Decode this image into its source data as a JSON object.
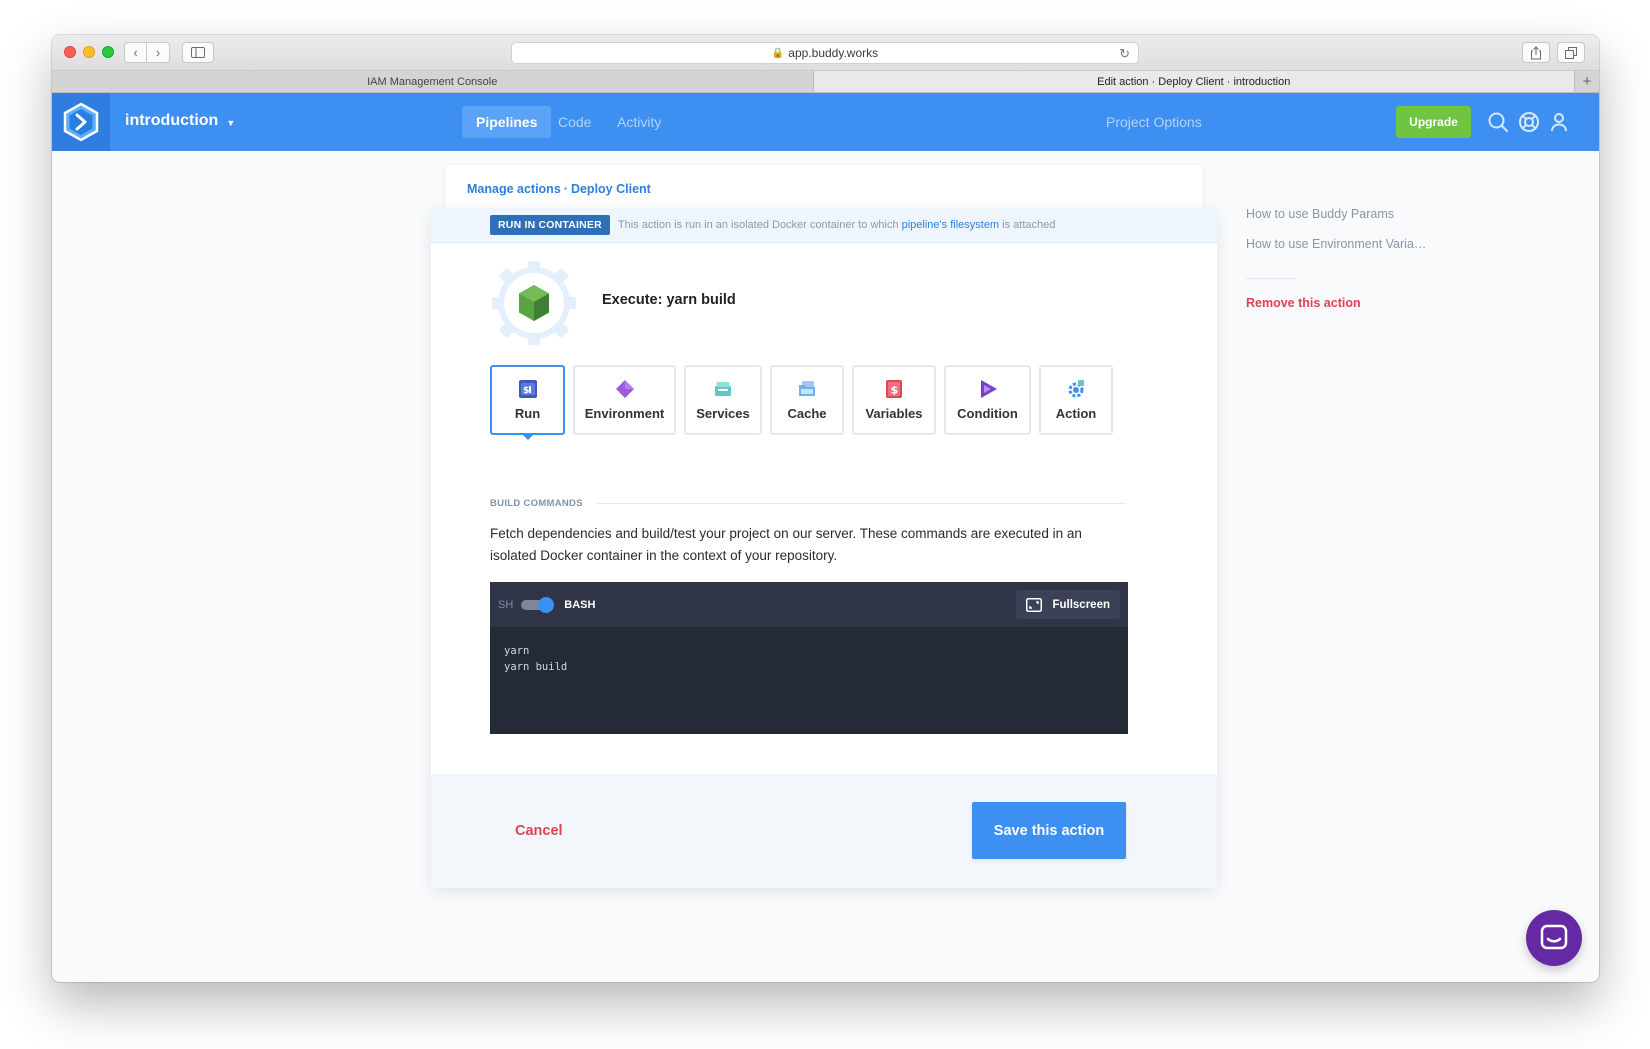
{
  "browser": {
    "url": "app.buddy.works",
    "tabs": [
      {
        "label": "IAM Management Console",
        "active": false
      },
      {
        "label": "Edit action · Deploy Client · introduction",
        "active": true
      }
    ]
  },
  "header": {
    "project": "introduction",
    "nav": [
      "Pipelines",
      "Code",
      "Activity"
    ],
    "project_options": "Project Options",
    "upgrade": "Upgrade",
    "colors": {
      "bar": "#3d8ff2",
      "upgrade": "#6fc440"
    }
  },
  "breadcrumb": {
    "manage": "Manage actions",
    "sep": "·",
    "pipeline": "Deploy Client"
  },
  "info": {
    "badge": "RUN IN CONTAINER",
    "text_before": "This action is run in an isolated Docker container to which",
    "link": "pipeline's filesystem",
    "text_after": "is attached"
  },
  "action": {
    "title": "Execute: yarn build",
    "icon": "nodejs-hexagon-icon"
  },
  "tabs": [
    {
      "label": "Run",
      "icon": "terminal-icon",
      "active": true
    },
    {
      "label": "Environment",
      "icon": "diamond-icon",
      "active": false
    },
    {
      "label": "Services",
      "icon": "services-box-icon",
      "active": false
    },
    {
      "label": "Cache",
      "icon": "cache-folder-icon",
      "active": false
    },
    {
      "label": "Variables",
      "icon": "variables-dollar-icon",
      "active": false
    },
    {
      "label": "Condition",
      "icon": "condition-play-icon",
      "active": false
    },
    {
      "label": "Action",
      "icon": "action-gear-icon",
      "active": false
    }
  ],
  "build": {
    "section": "BUILD COMMANDS",
    "description": "Fetch dependencies and build/test your project on our server. These commands are executed in an isolated Docker container in the context of your repository.",
    "shell_left": "SH",
    "shell_right": "BASH",
    "fullscreen": "Fullscreen",
    "code": "yarn\nyarn build"
  },
  "footer": {
    "cancel": "Cancel",
    "save": "Save this action"
  },
  "sidebar": {
    "links": [
      "How to use Buddy Params",
      "How to use Environment Varia…"
    ],
    "remove": "Remove this action"
  }
}
